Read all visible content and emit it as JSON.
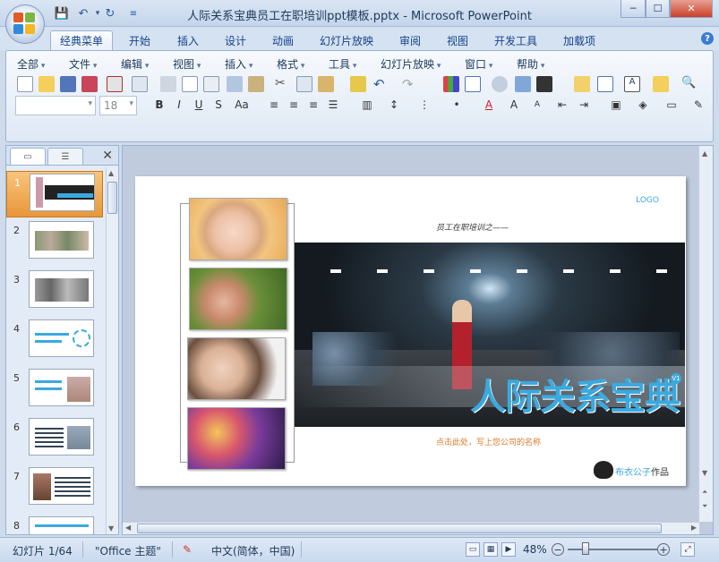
{
  "window": {
    "title": "人际关系宝典员工在职培训ppt模板.pptx - Microsoft PowerPoint",
    "controls": [
      "─",
      "☐",
      "✕"
    ]
  },
  "tabs": [
    "经典菜单",
    "开始",
    "插入",
    "设计",
    "动画",
    "幻灯片放映",
    "审阅",
    "视图",
    "开发工具",
    "加载项"
  ],
  "active_tab": "经典菜单",
  "menus": [
    "全部",
    "文件",
    "编辑",
    "视图",
    "插入",
    "格式",
    "工具",
    "幻灯片放映",
    "窗口",
    "帮助"
  ],
  "font_size": "18",
  "thumbnails": [
    {
      "num": "1"
    },
    {
      "num": "2"
    },
    {
      "num": "3"
    },
    {
      "num": "4"
    },
    {
      "num": "5"
    },
    {
      "num": "6"
    },
    {
      "num": "7"
    },
    {
      "num": "8"
    }
  ],
  "slide": {
    "logo": "LOGO",
    "subtitle": "员工在职培训之——",
    "main_title": "人际关系宝典",
    "company": "点击此处，写上您公司的名称",
    "author_name": "布衣公子",
    "author_suffix": "作品"
  },
  "status": {
    "slide_count": "幻灯片 1/64",
    "theme": "\"Office 主题\"",
    "language": "中文(简体，中国)",
    "zoom": "48%"
  },
  "colors": {
    "accent": "#2d5a9a",
    "title_blue": "#3aa9e0",
    "company_orange": "#e07a2a",
    "selection": "#e9963a"
  }
}
